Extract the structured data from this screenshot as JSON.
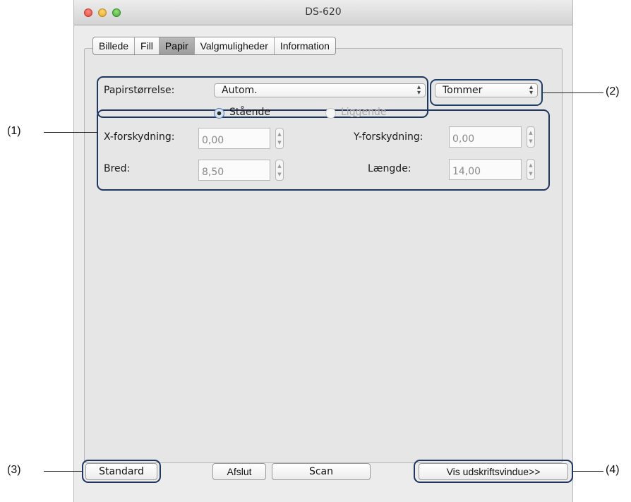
{
  "window": {
    "title": "DS-620"
  },
  "tabs": [
    {
      "label": "Billede"
    },
    {
      "label": "Fill"
    },
    {
      "label": "Papir",
      "active": true
    },
    {
      "label": "Valgmuligheder"
    },
    {
      "label": "Information"
    }
  ],
  "paper": {
    "size_label": "Papirstørrelse:",
    "size_value": "Autom.",
    "unit_value": "Tommer",
    "orientation": {
      "portrait_label": "Stående",
      "landscape_label": "Liggende",
      "selected": "portrait"
    },
    "x_offset_label": "X-forskydning:",
    "x_offset_value": "0,00",
    "y_offset_label": "Y-forskydning:",
    "y_offset_value": "0,00",
    "width_label": "Bred:",
    "width_value": "8,50",
    "length_label": "Længde:",
    "length_value": "14,00"
  },
  "buttons": {
    "standard": "Standard",
    "close": "Afslut",
    "scan": "Scan",
    "preview": "Vis udskriftsvindue>>"
  },
  "annotations": {
    "a1": "(1)",
    "a2": "(2)",
    "a3": "(3)",
    "a4": "(4)"
  },
  "colors": {
    "callout": "#1f3660",
    "active_tab": "#a8a8a8"
  }
}
